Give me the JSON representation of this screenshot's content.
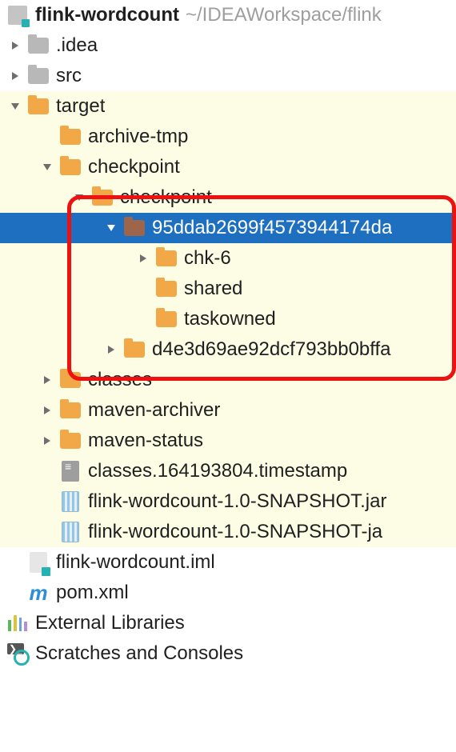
{
  "root": {
    "name": "flink-wordcount",
    "path_hint": "~/IDEAWorkspace/flink"
  },
  "tree": {
    "idea": ".idea",
    "src": "src",
    "target": "target",
    "archive_tmp": "archive-tmp",
    "checkpoint1": "checkpoint",
    "checkpoint2": "checkpoint",
    "hash1": "95ddab2699f4573944174da",
    "chk6": "chk-6",
    "shared": "shared",
    "taskowned": "taskowned",
    "hash2": "d4e3d69ae92dcf793bb0bffa",
    "classes": "classes",
    "maven_archiver": "maven-archiver",
    "maven_status": "maven-status",
    "ts_file": "classes.164193804.timestamp",
    "jar1": "flink-wordcount-1.0-SNAPSHOT.jar",
    "jar2": "flink-wordcount-1.0-SNAPSHOT-ja",
    "iml": "flink-wordcount.iml",
    "pom": "pom.xml",
    "ext_libs": "External Libraries",
    "scratches": "Scratches and Consoles"
  }
}
